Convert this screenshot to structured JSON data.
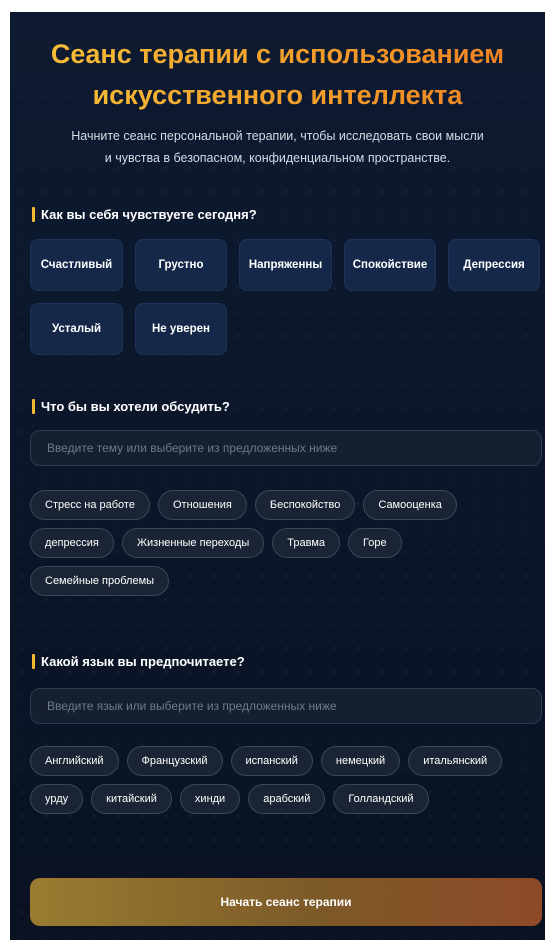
{
  "header": {
    "title_line1": "Сеанс терапии с использованием",
    "title_line2": "искусственного интеллекта",
    "subtitle_line1": "Начните сеанс персональной терапии, чтобы исследовать свои мысли",
    "subtitle_line2": "и чувства в безопасном, конфиденциальном пространстве."
  },
  "mood": {
    "label": "Как вы себя чувствуете сегодня?",
    "options": [
      "Счастливый",
      "Грустно",
      "Напряженны",
      "Спокойствие",
      "Депрессия",
      "Усталый",
      "Не уверен"
    ]
  },
  "topic": {
    "label": "Что бы вы хотели обсудить?",
    "placeholder": "Введите тему или выберите из предложенных ниже",
    "suggestions": [
      "Стресс на работе",
      "Отношения",
      "Беспокойство",
      "Самооценка",
      "депрессия",
      "Жизненные переходы",
      "Травма",
      "Горе",
      "Семейные проблемы"
    ]
  },
  "language": {
    "label": "Какой язык вы предпочитаете?",
    "placeholder": "Введите язык или выберите из предложенных ниже",
    "suggestions": [
      "Английский",
      "Французский",
      "испанский",
      "немецкий",
      "итальянский",
      "урду",
      "китайский",
      "хинди",
      "арабский",
      "Голландский"
    ]
  },
  "cta": {
    "label": "Начать сеанс терапии"
  },
  "colors": {
    "accent": "#f5b82e",
    "background": "#0b1426",
    "mood_button": "#15284a",
    "chip": "#1b2434"
  }
}
